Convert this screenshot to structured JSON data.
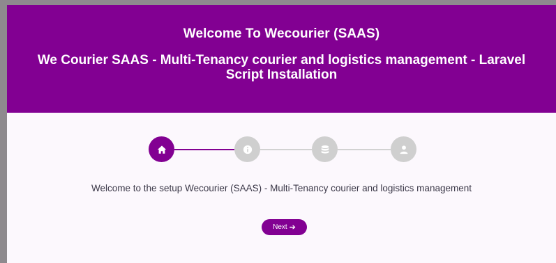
{
  "header": {
    "title": "Welcome To Wecourier (SAAS)",
    "subtitle": "We Courier SAAS - Multi-Tenancy courier and logistics management - Laravel Script Installation"
  },
  "stepper": {
    "steps": [
      {
        "icon": "home-icon",
        "state": "active"
      },
      {
        "icon": "info-icon",
        "state": "inactive"
      },
      {
        "icon": "database-icon",
        "state": "inactive"
      },
      {
        "icon": "user-icon",
        "state": "inactive"
      }
    ]
  },
  "content": {
    "welcome_text": "Welcome to the setup Wecourier (SAAS) - Multi-Tenancy courier and logistics management"
  },
  "actions": {
    "next_label": "Next",
    "next_arrow": "➔"
  },
  "colors": {
    "brand": "#820092",
    "inactive": "#cfcfcf",
    "page_bg": "#fcf8fd"
  }
}
